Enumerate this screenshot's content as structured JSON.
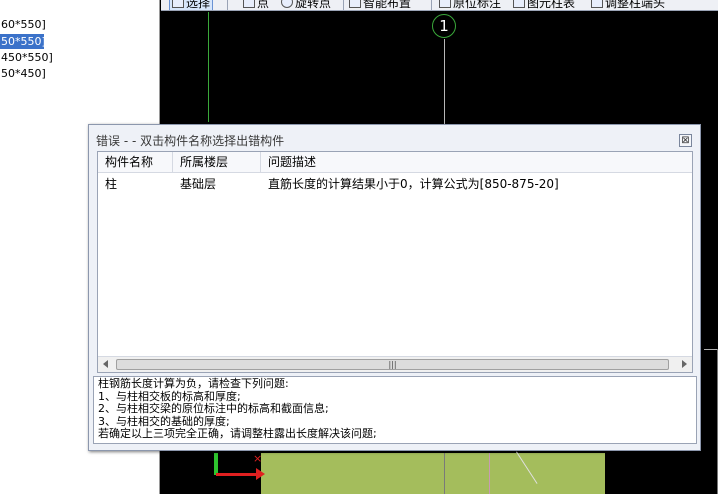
{
  "tree": {
    "items": [
      {
        "label": "60*550]",
        "selected": false
      },
      {
        "label": "50*550]",
        "selected": true
      },
      {
        "label": "450*550]",
        "selected": false
      },
      {
        "label": "50*450]",
        "selected": false
      }
    ]
  },
  "toolbar": {
    "select_label": "选择",
    "point_label": "点",
    "rotate_point_label": "旋转点",
    "smart_layout_label": "智能布置",
    "origin_mark_label": "原位标注",
    "figure_column_label": "图元柱表",
    "adjust_column_end_label": "调整柱端头"
  },
  "canvas": {
    "axis_number": "1"
  },
  "dialog": {
    "title": "错误 - - 双击构件名称选择出错构件",
    "close_symbol": "⊠",
    "columns": {
      "name": "构件名称",
      "floor": "所属楼层",
      "desc": "问题描述"
    },
    "rows": [
      {
        "name": "柱",
        "floor": "基础层",
        "desc": "直筋长度的计算结果小于0，计算公式为[850-875-20]"
      }
    ],
    "scroll_grip": "|||",
    "message": [
      "柱钢筋长度计算为负，请检查下列问题:",
      " 1、与柱相交板的标高和厚度;",
      " 2、与柱相交梁的原位标注中的标高和截面信息;",
      " 3、与柱相交的基础的厚度;",
      " 若确定以上三项完全正确，请调整柱露出长度解决该问题;"
    ]
  },
  "colors": {
    "accent_selected": "#3b72c9",
    "axis_green": "#3aa83a",
    "element_fill": "#a4bd5c"
  }
}
